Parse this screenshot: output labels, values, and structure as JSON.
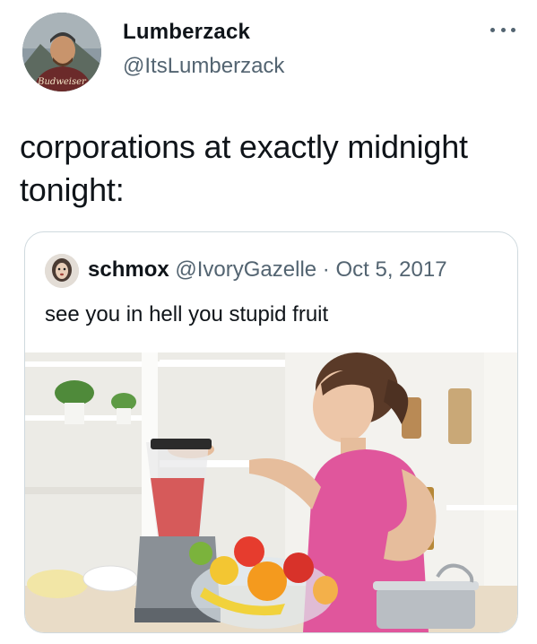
{
  "tweet": {
    "author": {
      "display_name": "Lumberzack",
      "handle": "@ItsLumberzack",
      "avatar_icon": "profile-photo",
      "avatar_caption": "Budweiser"
    },
    "more_icon": "ellipsis-icon",
    "text": "corporations at exactly midnight tonight:"
  },
  "quote": {
    "author": {
      "display_name": "schmox",
      "handle": "@IvoryGazelle",
      "separator": "·",
      "date": "Oct 5, 2017",
      "avatar_icon": "profile-photo"
    },
    "text": "see you in hell you stupid fruit",
    "media": {
      "type": "photo",
      "subject": "woman-using-blender-with-fruit-bowl"
    }
  },
  "colors": {
    "text_primary": "#0f1419",
    "text_secondary": "#536471",
    "card_border": "#cfd9de",
    "accent_pink": "#e0569c"
  }
}
